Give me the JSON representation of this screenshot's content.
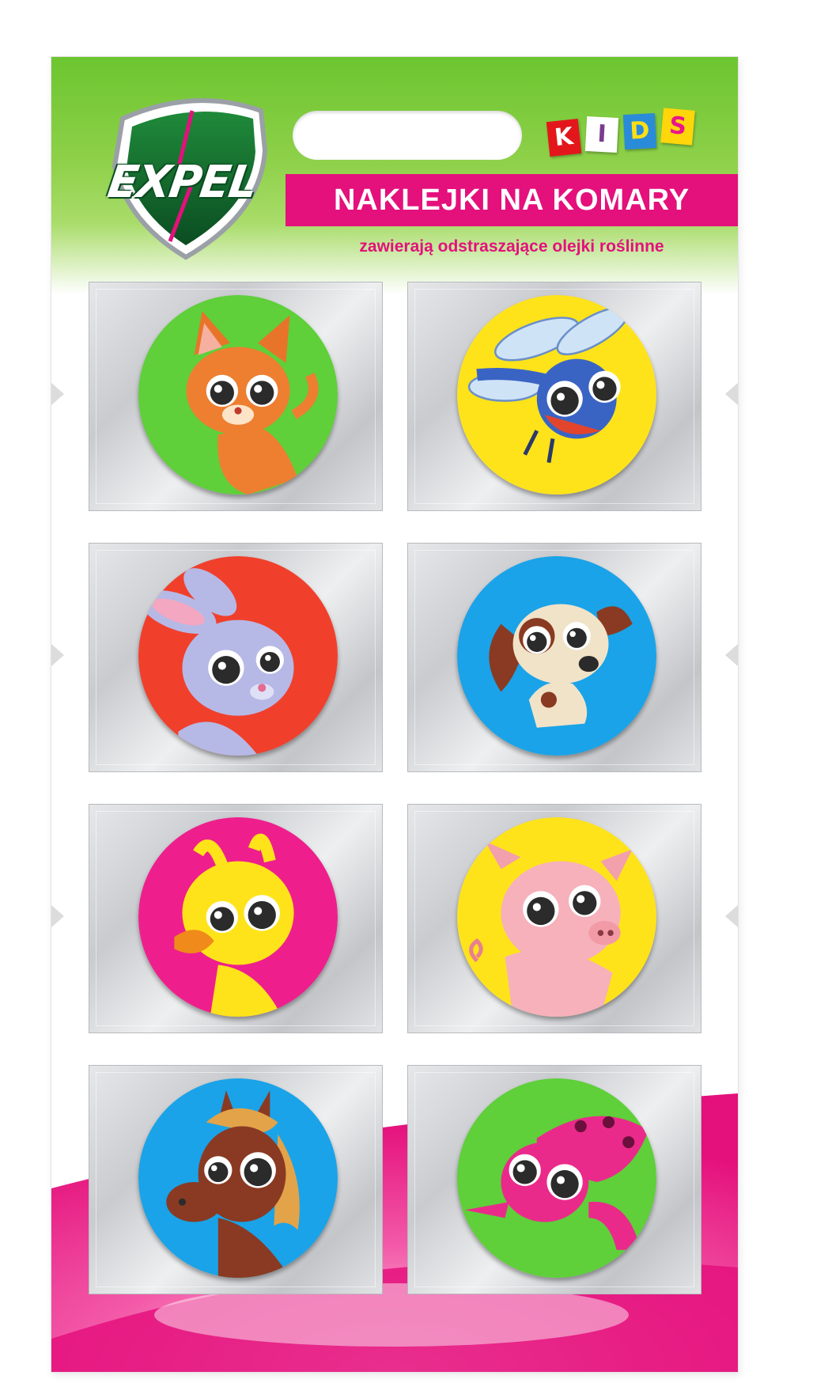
{
  "package": {
    "brand": "EXPEL",
    "kids_letters": [
      "K",
      "I",
      "D",
      "S"
    ],
    "title": "NAKLEJKI NA KOMARY",
    "subtitle": "zawierają odstraszające olejki roślinne"
  },
  "colors": {
    "header_green": "#6cc530",
    "title_magenta": "#e4107c",
    "shield_dark_green": "#0b4d22"
  },
  "stickers": [
    {
      "animal": "cat-icon",
      "background": "#5fcf3a"
    },
    {
      "animal": "dragonfly-icon",
      "background": "#ffe31a"
    },
    {
      "animal": "rabbit-icon",
      "background": "#f0402c"
    },
    {
      "animal": "puppy-icon",
      "background": "#1aa3e8"
    },
    {
      "animal": "duckling-icon",
      "background": "#ee1f8c"
    },
    {
      "animal": "piglet-icon",
      "background": "#ffe31a"
    },
    {
      "animal": "pony-icon",
      "background": "#1aa3e8"
    },
    {
      "animal": "lizard-icon",
      "background": "#5fcf3a"
    }
  ]
}
